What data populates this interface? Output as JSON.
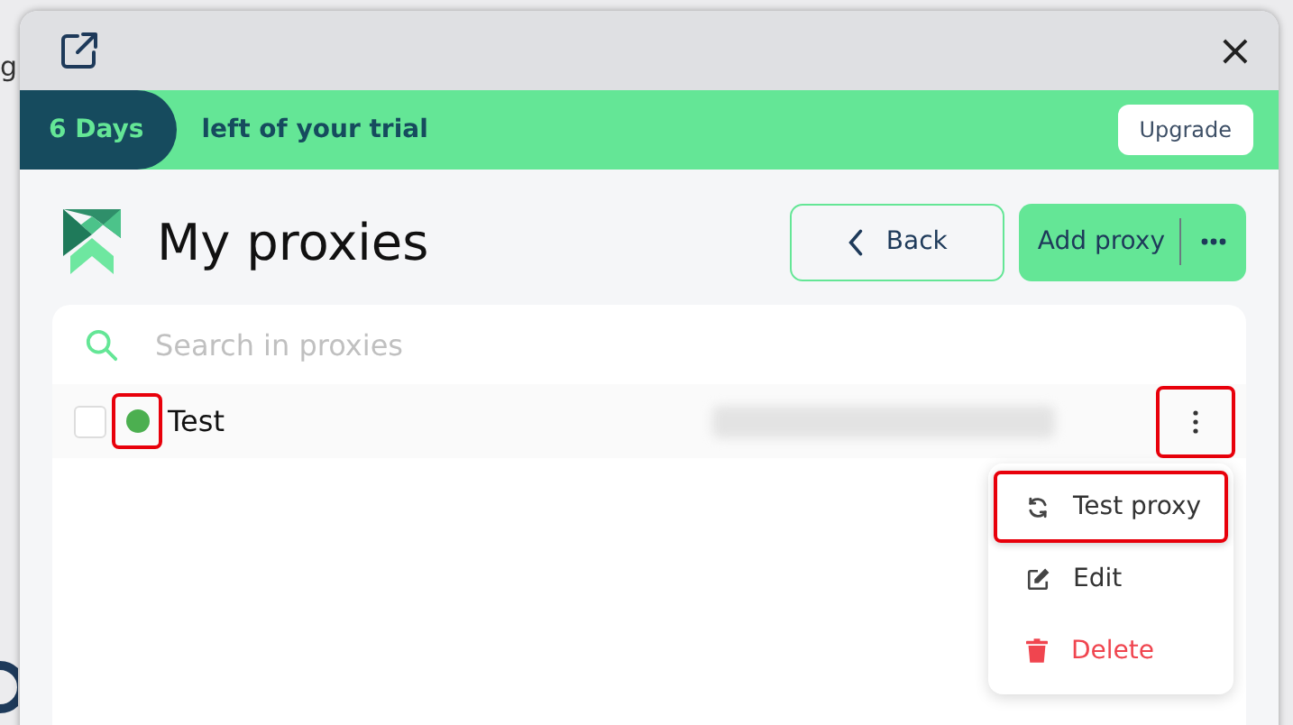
{
  "background_fragments": [
    "g"
  ],
  "window": {
    "close": "×"
  },
  "trial_banner": {
    "days": "6 Days",
    "text": "left of your trial",
    "button": "Upgrade"
  },
  "header": {
    "title": "My proxies",
    "back_button": "Back",
    "add_button": "Add proxy"
  },
  "search": {
    "placeholder": "Search in proxies"
  },
  "proxies": [
    {
      "name": "Test",
      "checked": false,
      "color": "#4caf50",
      "highlighted": true,
      "menu_highlighted": true
    }
  ],
  "menu": [
    {
      "kind": "test",
      "label": "Test proxy",
      "highlighted": true
    },
    {
      "kind": "edit",
      "label": "Edit",
      "highlighted": false
    },
    {
      "kind": "delete",
      "label": "Delete",
      "highlighted": false
    }
  ]
}
